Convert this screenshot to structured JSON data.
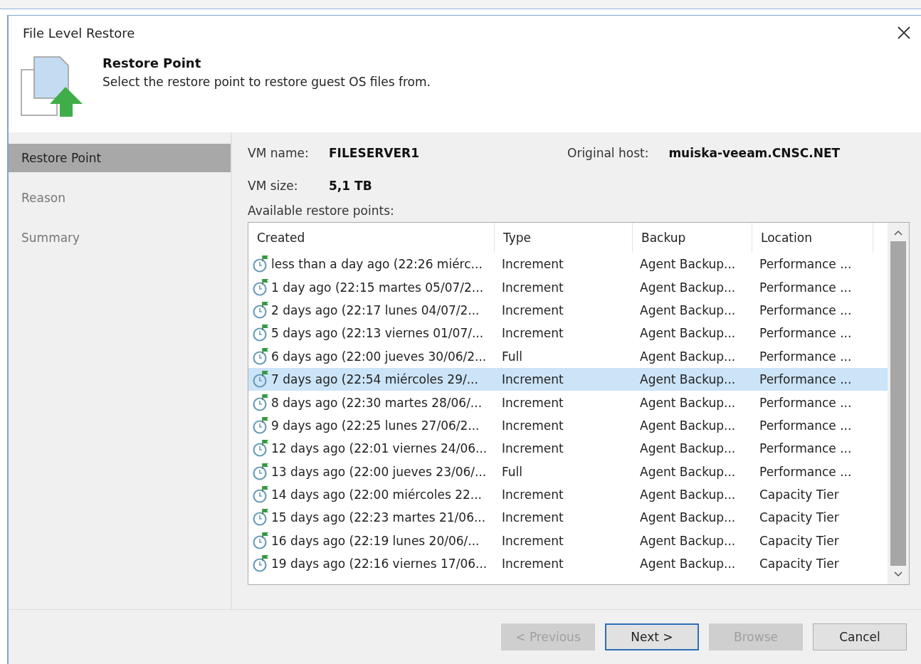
{
  "window": {
    "title": "File Level Restore"
  },
  "header": {
    "title": "Restore Point",
    "subtitle": "Select the restore point to restore guest OS files from."
  },
  "steps": [
    {
      "label": "Restore Point",
      "selected": true
    },
    {
      "label": "Reason",
      "selected": false
    },
    {
      "label": "Summary",
      "selected": false
    }
  ],
  "vm": {
    "name_label": "VM name:",
    "name": "FILESERVER1",
    "host_label": "Original host:",
    "host": "muiska-veeam.CNSC.NET",
    "size_label": "VM size:",
    "size": "5,1 TB"
  },
  "table": {
    "label": "Available restore points:",
    "columns": [
      "Created",
      "Type",
      "Backup",
      "Location"
    ],
    "rows": [
      {
        "created": "less than a day ago (22:26 miérc...",
        "type": "Increment",
        "backup": "Agent Backup...",
        "location": "Performance ...",
        "selected": false
      },
      {
        "created": "1 day ago (22:15 martes 05/07/2...",
        "type": "Increment",
        "backup": "Agent Backup...",
        "location": "Performance ...",
        "selected": false
      },
      {
        "created": "2 days ago (22:17 lunes 04/07/2...",
        "type": "Increment",
        "backup": "Agent Backup...",
        "location": "Performance ...",
        "selected": false
      },
      {
        "created": "5 days ago (22:13 viernes 01/07/...",
        "type": "Increment",
        "backup": "Agent Backup...",
        "location": "Performance ...",
        "selected": false
      },
      {
        "created": "6 days ago (22:00 jueves 30/06/2...",
        "type": "Full",
        "backup": "Agent Backup...",
        "location": "Performance ...",
        "selected": false
      },
      {
        "created": "7 days ago (22:54 miércoles 29/...",
        "type": "Increment",
        "backup": "Agent Backup...",
        "location": "Performance ...",
        "selected": true
      },
      {
        "created": "8 days ago (22:30 martes 28/06/...",
        "type": "Increment",
        "backup": "Agent Backup...",
        "location": "Performance ...",
        "selected": false
      },
      {
        "created": "9 days ago (22:25 lunes 27/06/2...",
        "type": "Increment",
        "backup": "Agent Backup...",
        "location": "Performance ...",
        "selected": false
      },
      {
        "created": "12 days ago (22:01 viernes 24/06...",
        "type": "Increment",
        "backup": "Agent Backup...",
        "location": "Performance ...",
        "selected": false
      },
      {
        "created": "13 days ago (22:00 jueves 23/06/...",
        "type": "Full",
        "backup": "Agent Backup...",
        "location": "Performance ...",
        "selected": false
      },
      {
        "created": "14 days ago (22:00 miércoles 22...",
        "type": "Increment",
        "backup": "Agent Backup...",
        "location": "Capacity Tier",
        "selected": false
      },
      {
        "created": "15 days ago (22:23 martes 21/06...",
        "type": "Increment",
        "backup": "Agent Backup...",
        "location": "Capacity Tier",
        "selected": false
      },
      {
        "created": "16 days ago (22:19 lunes 20/06/...",
        "type": "Increment",
        "backup": "Agent Backup...",
        "location": "Capacity Tier",
        "selected": false
      },
      {
        "created": "19 days ago (22:16 viernes 17/06...",
        "type": "Increment",
        "backup": "Agent Backup...",
        "location": "Capacity Tier",
        "selected": false
      }
    ]
  },
  "buttons": [
    {
      "label": "< Previous",
      "disabled": true,
      "default": false
    },
    {
      "label": "Next >",
      "disabled": false,
      "default": true
    },
    {
      "label": "Browse",
      "disabled": true,
      "default": false
    },
    {
      "label": "Cancel",
      "disabled": false,
      "default": false
    }
  ]
}
